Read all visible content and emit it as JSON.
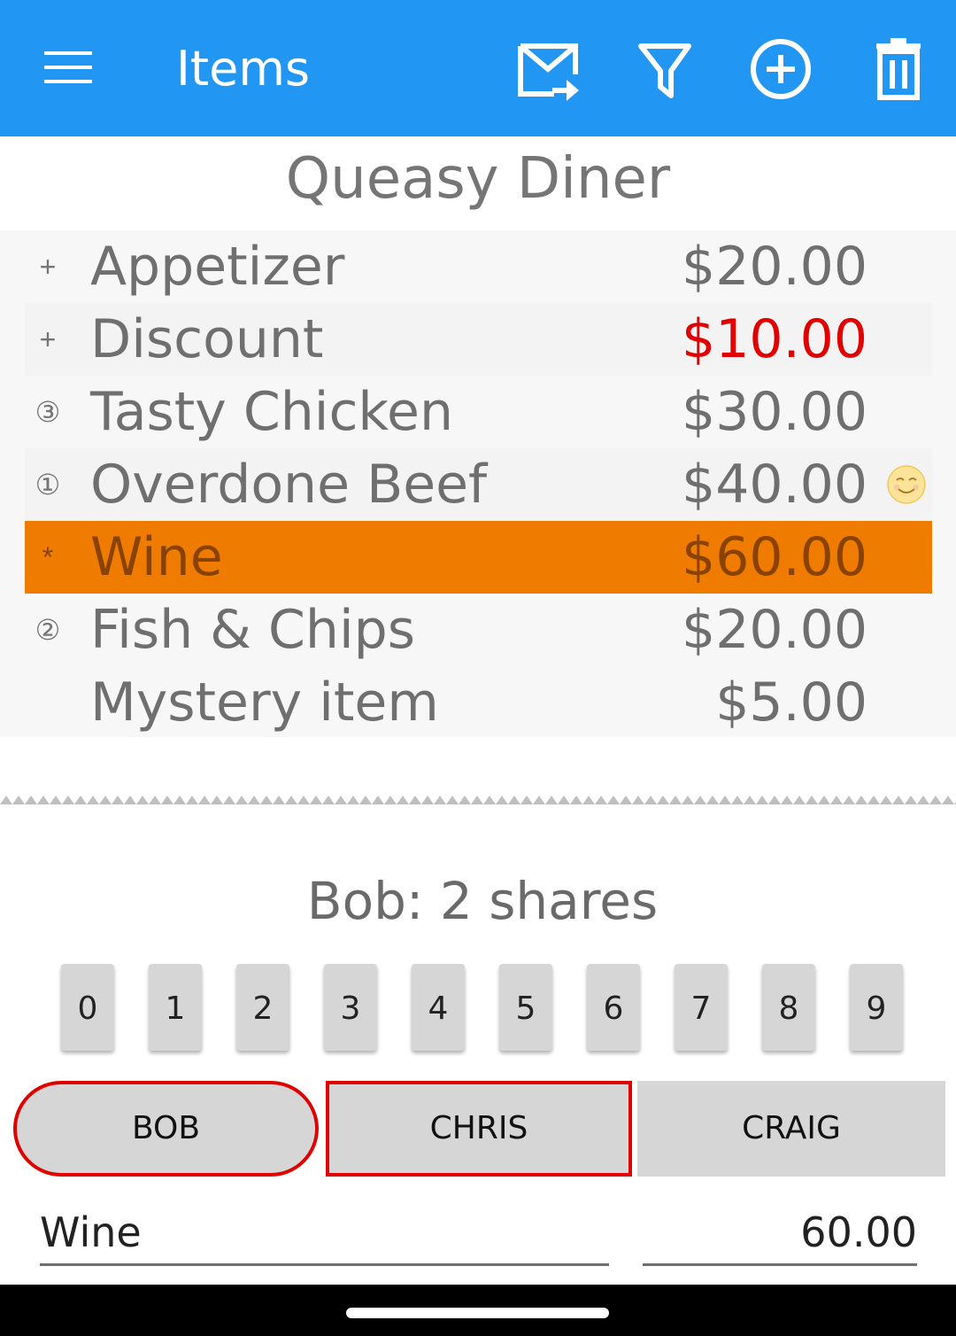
{
  "app_bar": {
    "title": "Items",
    "background": "#2196F3",
    "icons": [
      "menu-icon",
      "email-forward-icon",
      "filter-icon",
      "add-circle-icon",
      "delete-icon"
    ]
  },
  "restaurant_name": "Queasy Diner",
  "items": [
    {
      "mark": "+",
      "name": "Appetizer",
      "price": "$20.00"
    },
    {
      "mark": "+",
      "name": "Discount",
      "price": "$10.00",
      "price_color": "#E00000"
    },
    {
      "mark": "③",
      "name": "Tasty Chicken",
      "price": "$30.00"
    },
    {
      "mark": "①",
      "name": "Overdone Beef",
      "price": "$40.00",
      "extra_icon": "smiling-face-icon"
    },
    {
      "mark": "*",
      "name": "Wine",
      "price": "$60.00",
      "selected": true,
      "highlight_color": "#EF7C00"
    },
    {
      "mark": "②",
      "name": "Fish & Chips",
      "price": "$20.00"
    },
    {
      "mark": "",
      "name": "Mystery item",
      "price": "$5.00"
    }
  ],
  "shares_label": "Bob: 2 shares",
  "digits": [
    "0",
    "1",
    "2",
    "3",
    "4",
    "5",
    "6",
    "7",
    "8",
    "9"
  ],
  "people": [
    "BOB",
    "CHRIS",
    "CRAIG"
  ],
  "edit": {
    "item_name": "Wine",
    "amount": "60.00"
  }
}
